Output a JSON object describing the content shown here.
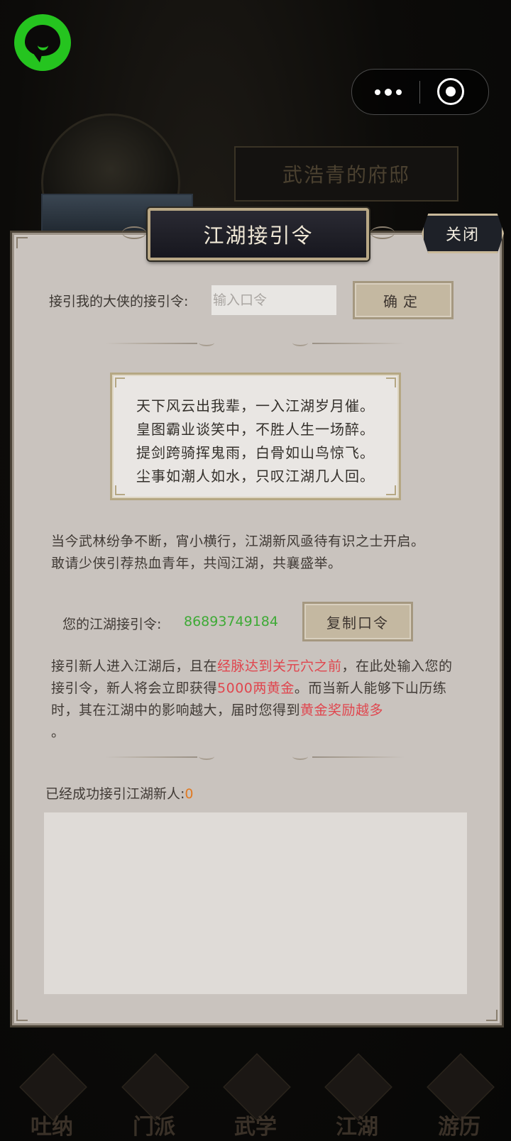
{
  "background": {
    "mansion_title": "武浩青的府邸"
  },
  "bottom_nav": [
    "吐纳",
    "门派",
    "武学",
    "江湖",
    "游历"
  ],
  "modal": {
    "title": "江湖接引令",
    "close_label": "关闭",
    "invite_label": "接引我的大侠的接引令:",
    "input_placeholder": "输入口令",
    "input_value": "",
    "confirm_label": "确定",
    "poem": [
      "天下风云出我辈，一入江湖岁月催。",
      "皇图霸业谈笑中，不胜人生一场醉。",
      "提剑跨骑挥鬼雨，白骨如山鸟惊飞。",
      "尘事如潮人如水，只叹江湖几人回。"
    ],
    "intro_lines": [
      "当今武林纷争不断，宵小横行，江湖新风亟待有识之士开启。",
      "敢请少侠引荐热血青年，共闯江湖，共襄盛举。"
    ],
    "your_code_label": "您的江湖接引令:",
    "your_code_value": "86893749184",
    "copy_label": "复制口令",
    "rules": {
      "p1": "接引新人进入江湖后，且在",
      "h1": "经脉达到关元穴之前",
      "p2": "，在此处输入您的接引令，新人将会立即获得",
      "h2": "5000两黄金",
      "p3": "。而当新人能够下山历练时，其在江湖中的影响越大，届时您得到",
      "h3": "黄金奖励越多",
      "p4": "。"
    },
    "success_label": "已经成功接引江湖新人:",
    "success_count": "0"
  },
  "colors": {
    "highlight_red": "#e0464e",
    "code_green": "#3eaa36",
    "count_orange": "#e07a23",
    "logo_green": "#25c41f"
  }
}
